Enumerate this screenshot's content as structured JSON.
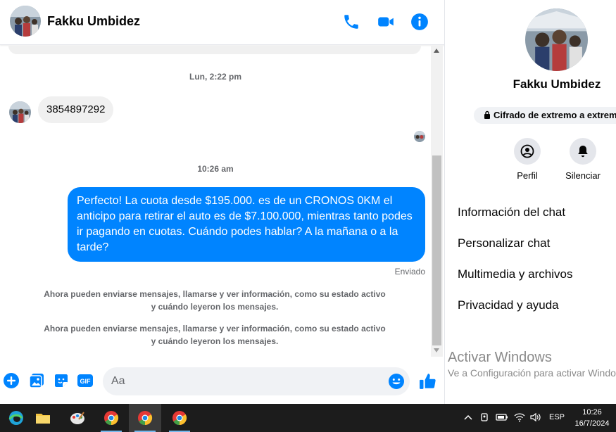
{
  "chat": {
    "contact_name": "Fakku Umbidez",
    "timestamps": [
      "Lun, 2:22 pm",
      "10:26 am"
    ],
    "incoming_message": "3854897292",
    "outgoing_message": "Perfecto! La cuota desde $195.000. es de un CRONOS 0KM el anticipo para retirar el auto es de $7.100.000, mientras tanto podes ir pagando en cuotas. Cuándo podes hablar? A la mañana o a la tarde?",
    "sent_status": "Enviado",
    "notices": [
      "Ahora pueden enviarse mensajes, llamarse y ver información, como su estado activo y cuándo leyeron los mensajes.",
      "Ahora pueden enviarse mensajes, llamarse y ver información, como su estado activo y cuándo leyeron los mensajes."
    ],
    "composer_placeholder": "Aa"
  },
  "info_panel": {
    "name": "Fakku Umbidez",
    "encryption_badge": "Cifrado de extremo a extremo",
    "actions": [
      {
        "label": "Perfil",
        "icon": "profile-icon"
      },
      {
        "label": "Silenciar",
        "icon": "bell-icon"
      }
    ],
    "menu": [
      "Información del chat",
      "Personalizar chat",
      "Multimedia y archivos",
      "Privacidad y ayuda"
    ]
  },
  "watermark": {
    "title": "Activar Windows",
    "subtitle": "Ve a Configuración para activar Windows."
  },
  "taskbar": {
    "language": "ESP",
    "time": "10:26",
    "date": "16/7/2024"
  },
  "colors": {
    "accent": "#0084ff",
    "bubble_incoming": "#f0f0f0",
    "taskbar": "#1c1c1c"
  }
}
